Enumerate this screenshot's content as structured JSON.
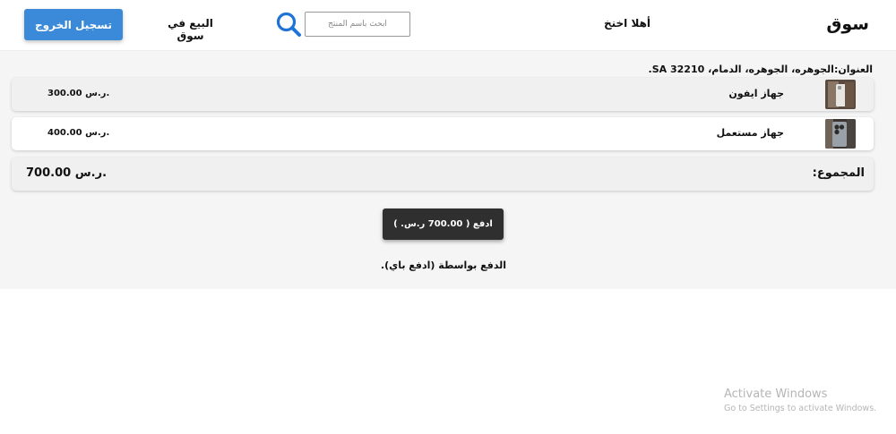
{
  "header": {
    "brand": "سوق",
    "greeting": "أهلا اخنخ",
    "search_placeholder": "ابحث باسم المنتج",
    "sell_link": "البيع في سوق",
    "logout_label": "تسجيل الخروج"
  },
  "cart": {
    "address": "العنوان:الجوهره، الجوهره، الدمام، 32210 SA.",
    "items": [
      {
        "name": "جهاز ايفون",
        "price": "300.00 ر.س."
      },
      {
        "name": "جهاز مستعمل",
        "price": "400.00 ر.س."
      }
    ],
    "total_label": "المجموع:",
    "total_value": "700.00 ر.س.",
    "pay_button_label": "ادفع ( 700.00 ر.س. )",
    "pay_note": "الدفع بواسطة (ادفع باي)."
  },
  "watermark": {
    "title": "Activate Windows",
    "subtitle": "Go to Settings to activate Windows."
  },
  "colors": {
    "accent": "#3b8ad9",
    "pay_button": "#2f2f2f",
    "search_icon": "#1f73d6",
    "page_background": "#f5f5f5"
  }
}
